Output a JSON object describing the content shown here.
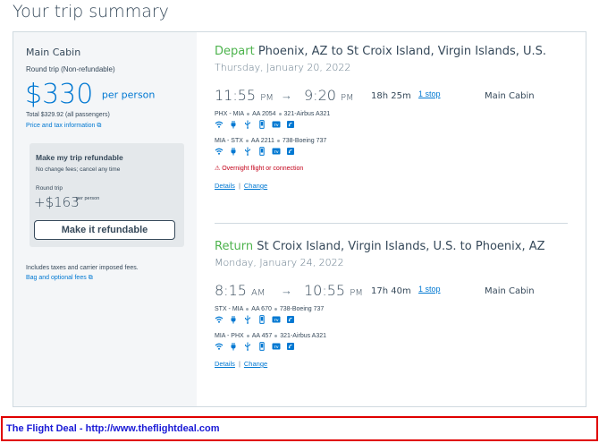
{
  "page_title": "Your trip summary",
  "sidebar": {
    "cabin": "Main Cabin",
    "trip_type": "Round trip (Non-refundable)",
    "price": "$330",
    "per_person": "per person",
    "total": "Total $329.92 (all passengers)",
    "price_tax_link": "Price and tax information",
    "refund": {
      "title": "Make my trip refundable",
      "subtitle": "No change fees; cancel any time",
      "round_trip": "Round trip",
      "price": "+$163",
      "per_person": "per person",
      "button": "Make it refundable"
    },
    "includes": "Includes taxes and carrier imposed fees.",
    "bag_link": "Bag and optional fees"
  },
  "depart": {
    "keyword": "Depart",
    "route": "Phoenix, AZ to St Croix Island, Virgin Islands, U.S.",
    "date": "Thursday, January 20, 2022",
    "dep_time": "11:55",
    "dep_ampm": "PM",
    "arr_time": "9:20",
    "arr_ampm": "PM",
    "duration": "18h 25m",
    "stops": "1 stop",
    "cabin": "Main Cabin",
    "legs": [
      {
        "route": "PHX - MIA",
        "flight": "AA 2054",
        "aircraft": "321-Airbus A321"
      },
      {
        "route": "MIA - STX",
        "flight": "AA 2211",
        "aircraft": "738-Boeing 737"
      }
    ],
    "warning": "Overnight flight or connection",
    "details": "Details",
    "change": "Change"
  },
  "return": {
    "keyword": "Return",
    "route": "St Croix Island, Virgin Islands, U.S. to Phoenix, AZ",
    "date": "Monday, January 24, 2022",
    "dep_time": "8:15",
    "dep_ampm": "AM",
    "arr_time": "10:55",
    "arr_ampm": "PM",
    "duration": "17h 40m",
    "stops": "1 stop",
    "cabin": "Main Cabin",
    "legs": [
      {
        "route": "STX - MIA",
        "flight": "AA 670",
        "aircraft": "738-Boeing 737"
      },
      {
        "route": "MIA - PHX",
        "flight": "AA 457",
        "aircraft": "321-Airbus A321"
      }
    ],
    "details": "Details",
    "change": "Change"
  },
  "footer": "The Flight Deal - http://www.theflightdeal.com",
  "amenity_icons": [
    "wifi-icon",
    "power-icon",
    "usb-icon",
    "phone-entertainment-icon",
    "tv-icon",
    "streaming-icon"
  ],
  "colors": {
    "blue": "#0078d2",
    "green": "#4db34d",
    "red": "#c30019",
    "text": "#36495a"
  }
}
